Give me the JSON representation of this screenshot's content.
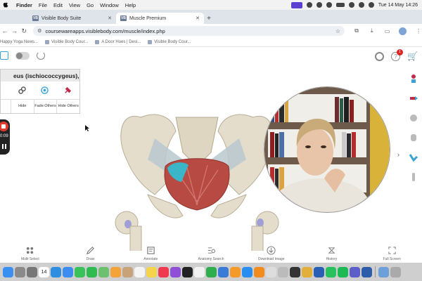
{
  "menubar": {
    "app": "Finder",
    "items": [
      "File",
      "Edit",
      "View",
      "Go",
      "Window",
      "Help"
    ],
    "clock": "Tue 14 May  14:26"
  },
  "browser": {
    "tabs": [
      {
        "favicon": "VB",
        "label": "Visible Body Suite"
      },
      {
        "favicon": "VB",
        "label": "Muscle Premium"
      }
    ],
    "new_tab": "+",
    "url": "coursewareapps.visiblebody.com/muscle/index.php",
    "bookmarks": [
      "Happy Yoga News...",
      "Visible Body Cour...",
      "A Door Hues | Desi...",
      "Visible Body Cour..."
    ]
  },
  "panel": {
    "title": "eus (ischiococcygeus), L",
    "actions": [
      "Hide",
      "Fade Others",
      "Hide Others"
    ]
  },
  "recorder": {
    "time": "0:09"
  },
  "notifications": {
    "count": "1"
  },
  "bottom_toolbar": [
    "Multi Select",
    "Draw",
    "Annotate",
    "Anatomy Search",
    "Download Image",
    "History",
    "Full Screen"
  ],
  "dock": {
    "calendar_day": "14"
  },
  "colors": {
    "accent": "#3aa3d4",
    "muscle": "#b84a44",
    "bone": "#e4ddcc",
    "highlight": "#3bb6c8",
    "record": "#e03a30"
  }
}
